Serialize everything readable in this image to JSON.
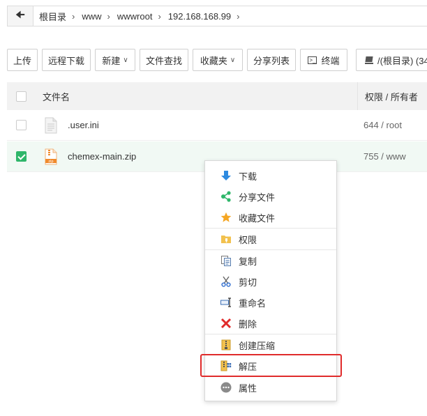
{
  "breadcrumb": {
    "items": [
      "根目录",
      "www",
      "wwwroot",
      "192.168.168.99"
    ]
  },
  "toolbar": {
    "upload": "上传",
    "remote_download": "远程下载",
    "new": "新建",
    "file_search": "文件查找",
    "favorites": "收藏夹",
    "share_list": "分享列表",
    "terminal": "终端",
    "disk": "/(根目录) (34"
  },
  "table": {
    "col_name": "文件名",
    "col_perm": "权限 / 所有者",
    "rows": [
      {
        "name": ".user.ini",
        "perm": "644 / root",
        "selected": false,
        "icon": "text-file-icon"
      },
      {
        "name": "chemex-main.zip",
        "perm": "755 / www",
        "selected": true,
        "icon": "zip-file-icon"
      }
    ]
  },
  "context_menu": {
    "items": [
      {
        "label": "下载",
        "icon": "download-arrow-icon"
      },
      {
        "label": "分享文件",
        "icon": "share-icon"
      },
      {
        "label": "收藏文件",
        "icon": "star-icon"
      },
      {
        "label": "权限",
        "icon": "permission-folder-icon"
      },
      {
        "label": "复制",
        "icon": "copy-icon"
      },
      {
        "label": "剪切",
        "icon": "scissors-icon"
      },
      {
        "label": "重命名",
        "icon": "rename-icon"
      },
      {
        "label": "删除",
        "icon": "delete-x-icon"
      },
      {
        "label": "创建压缩",
        "icon": "compress-icon"
      },
      {
        "label": "解压",
        "icon": "extract-icon"
      },
      {
        "label": "属性",
        "icon": "properties-dots-icon"
      }
    ],
    "highlighted": "解压"
  },
  "colors": {
    "accent_green": "#2fb66a",
    "highlight_red": "#e02b2b",
    "download_blue": "#2d8ae0",
    "star_orange": "#f5a623"
  }
}
